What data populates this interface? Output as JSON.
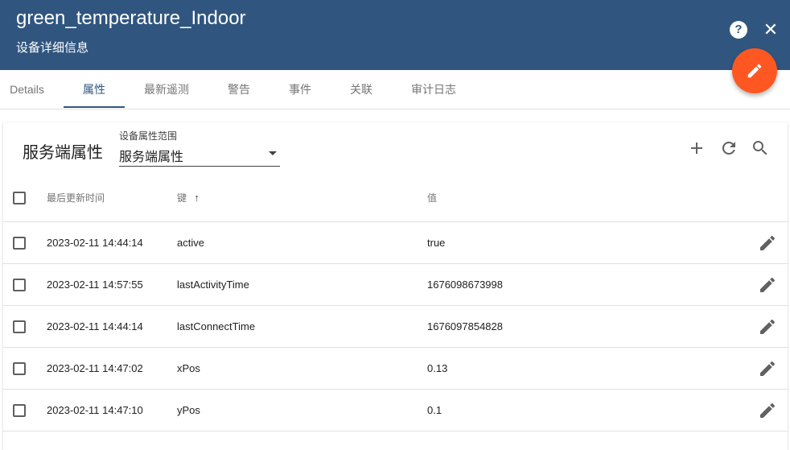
{
  "header": {
    "device_name": "green_temperature_Indoor",
    "subtitle": "设备详细信息",
    "help_label": "?",
    "close_label": "✕"
  },
  "tabs": [
    {
      "label": "Details",
      "active": false
    },
    {
      "label": "属性",
      "active": true
    },
    {
      "label": "最新遥测",
      "active": false
    },
    {
      "label": "警告",
      "active": false
    },
    {
      "label": "事件",
      "active": false
    },
    {
      "label": "关联",
      "active": false
    },
    {
      "label": "审计日志",
      "active": false
    }
  ],
  "card": {
    "title": "服务端属性",
    "scope": {
      "label": "设备属性范围",
      "value": "服务端属性"
    }
  },
  "table": {
    "columns": {
      "last_update": "最后更新时间",
      "key": "键",
      "key_sort": "↑",
      "value": "值"
    },
    "rows": [
      {
        "time": "2023-02-11 14:44:14",
        "key": "active",
        "value": "true"
      },
      {
        "time": "2023-02-11 14:57:55",
        "key": "lastActivityTime",
        "value": "1676098673998"
      },
      {
        "time": "2023-02-11 14:44:14",
        "key": "lastConnectTime",
        "value": "1676097854828"
      },
      {
        "time": "2023-02-11 14:47:02",
        "key": "xPos",
        "value": "0.13"
      },
      {
        "time": "2023-02-11 14:47:10",
        "key": "yPos",
        "value": "0.1"
      }
    ]
  },
  "colors": {
    "header_bg": "#305680",
    "fab_bg": "#ff5722",
    "active_tab": "#305680"
  },
  "icons": {
    "help": "help-circle-icon",
    "close": "close-icon",
    "fab": "pencil-icon",
    "add": "plus-icon",
    "refresh": "refresh-icon",
    "search": "search-icon",
    "row_edit": "pencil-icon"
  }
}
